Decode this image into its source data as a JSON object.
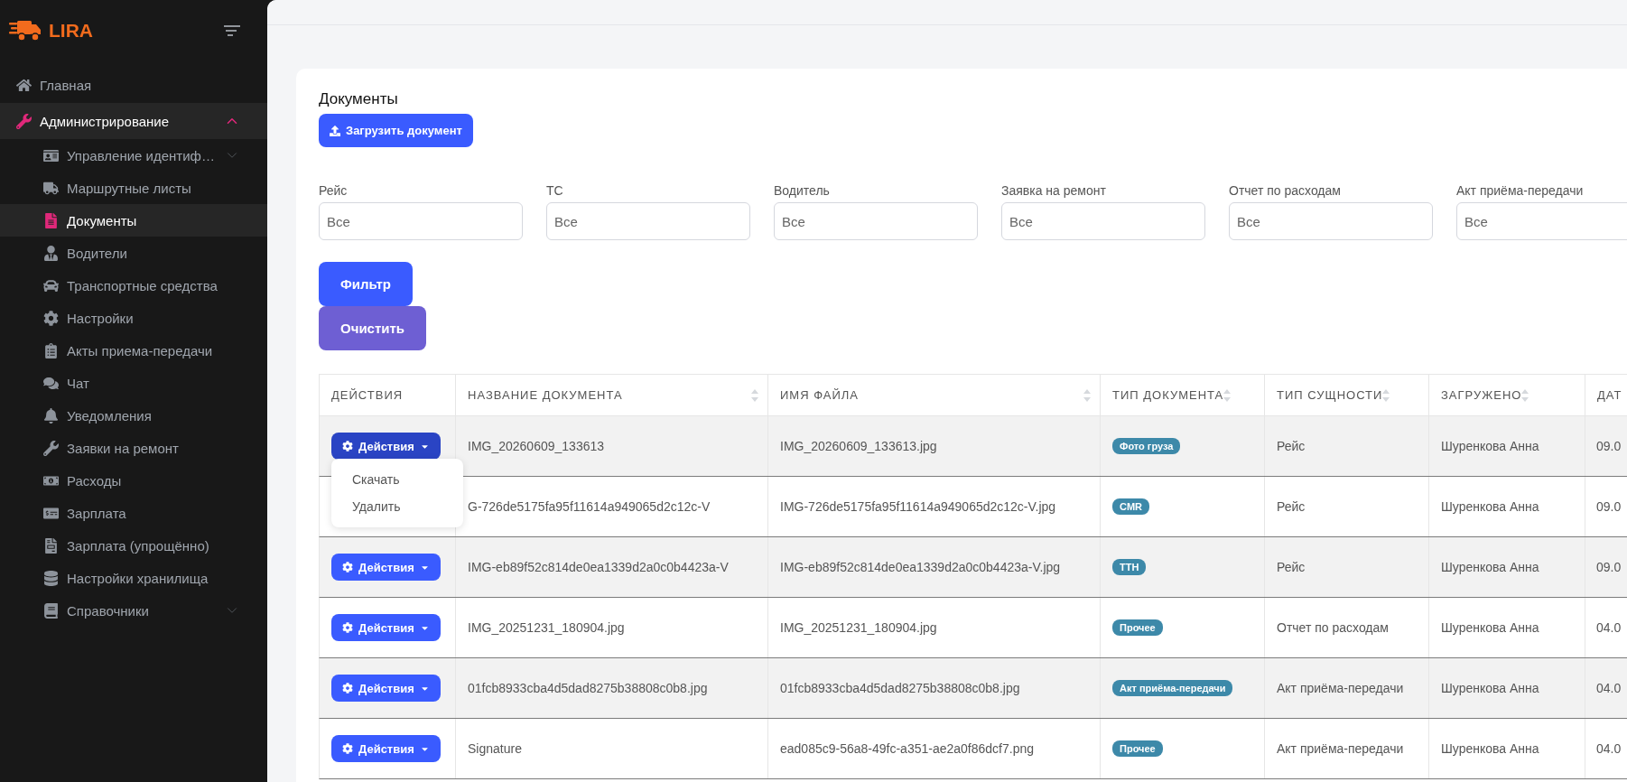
{
  "logo": {
    "text": "LIRA"
  },
  "sidebar": {
    "items": [
      {
        "label": "Главная",
        "selected": false
      },
      {
        "label": "Администрирование",
        "expanded": true,
        "children": [
          {
            "label": "Управление идентиф…",
            "selected": false,
            "expanded": false
          },
          {
            "label": "Маршрутные листы",
            "selected": false
          },
          {
            "label": "Документы",
            "selected": true
          },
          {
            "label": "Водители",
            "selected": false
          },
          {
            "label": "Транспортные средства",
            "selected": false
          },
          {
            "label": "Настройки",
            "selected": false
          },
          {
            "label": "Акты приема-передачи",
            "selected": false
          },
          {
            "label": "Чат",
            "selected": false
          },
          {
            "label": "Уведомления",
            "selected": false
          },
          {
            "label": "Заявки на ремонт",
            "selected": false
          },
          {
            "label": "Расходы",
            "selected": false
          },
          {
            "label": "Зарплата",
            "selected": false
          },
          {
            "label": "Зарплата (упрощённо)",
            "selected": false
          },
          {
            "label": "Настройки хранилища",
            "selected": false
          },
          {
            "label": "Справочники",
            "selected": false,
            "expanded": false
          }
        ]
      }
    ]
  },
  "page": {
    "title": "Документы",
    "upload_button": "Загрузить документ"
  },
  "filters": [
    {
      "label": "Рейс",
      "placeholder": "Все"
    },
    {
      "label": "ТС",
      "placeholder": "Все"
    },
    {
      "label": "Водитель",
      "placeholder": "Все"
    },
    {
      "label": "Заявка на ремонт",
      "placeholder": "Все"
    },
    {
      "label": "Отчет по расходам",
      "placeholder": "Все"
    },
    {
      "label": "Акт приёма-передачи",
      "placeholder": "Все"
    }
  ],
  "buttons": {
    "filter": "Фильтр",
    "clear": "Очистить"
  },
  "table": {
    "columns": [
      {
        "label": "ДЕЙСТВИЯ",
        "sortable": false
      },
      {
        "label": "НАЗВАНИЕ ДОКУМЕНТА",
        "sortable": true
      },
      {
        "label": "ИМЯ ФАЙЛА",
        "sortable": true
      },
      {
        "label": "ТИП ДОКУМЕНТА",
        "sortable": true
      },
      {
        "label": "ТИП СУЩНОСТИ",
        "sortable": true
      },
      {
        "label": "ЗАГРУЖЕНО",
        "sortable": true
      },
      {
        "label": "ДАТ"
      }
    ],
    "rows": [
      {
        "action": {
          "label": "Действия",
          "open": true,
          "menu": [
            "Скачать",
            "Удалить"
          ]
        },
        "name": "IMG_20260609_133613",
        "file": "IMG_20260609_133613.jpg",
        "doc_type": "Фото груза",
        "entity": "Рейс",
        "uploaded_by": "Шуренкова Анна",
        "date": "09.0"
      },
      {
        "name": "G-726de5175fa95f11614a949065d2c12c-V",
        "file": "IMG-726de5175fa95f11614a949065d2c12c-V.jpg",
        "doc_type": "CMR",
        "entity": "Рейс",
        "uploaded_by": "Шуренкова Анна",
        "date": "09.0"
      },
      {
        "action": {
          "label": "Действия",
          "open": false
        },
        "name": "IMG-eb89f52c814de0ea1339d2a0c0b4423a-V",
        "file": "IMG-eb89f52c814de0ea1339d2a0c0b4423a-V.jpg",
        "doc_type": "ТТН",
        "entity": "Рейс",
        "uploaded_by": "Шуренкова Анна",
        "date": "09.0"
      },
      {
        "action": {
          "label": "Действия",
          "open": false
        },
        "name": "IMG_20251231_180904.jpg",
        "file": "IMG_20251231_180904.jpg",
        "doc_type": "Прочее",
        "entity": "Отчет по расходам",
        "uploaded_by": "Шуренкова Анна",
        "date": "04.0"
      },
      {
        "action": {
          "label": "Действия",
          "open": false
        },
        "name": "01fcb8933cba4d5dad8275b38808c0b8.jpg",
        "file": "01fcb8933cba4d5dad8275b38808c0b8.jpg",
        "doc_type": "Акт приёма-передачи",
        "entity": "Акт приёма-передачи",
        "uploaded_by": "Шуренкова Анна",
        "date": "04.0"
      },
      {
        "action": {
          "label": "Действия",
          "open": false
        },
        "name": "Signature",
        "file": "ead085c9-56a8-49fc-a351-ae2a0f86dcf7.png",
        "doc_type": "Прочее",
        "entity": "Акт приёма-передачи",
        "uploaded_by": "Шуренкова Анна",
        "date": "04.0"
      }
    ]
  }
}
